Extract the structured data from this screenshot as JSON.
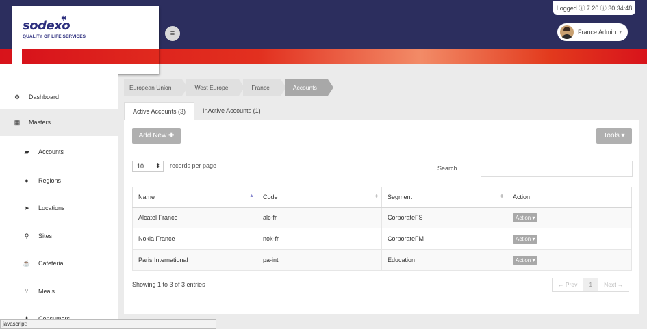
{
  "brand": {
    "name": "sodexo",
    "tagline": "QUALITY OF LIFE SERVICES",
    "primary_color": "#2c2e5e",
    "accent_color": "#d8131b"
  },
  "header": {
    "logged_text": "Logged ⓘ 7.26 ⓘ 30:34:48",
    "user_name": "France Admin",
    "menu_icon": "hamburger-icon"
  },
  "sidebar": {
    "items": [
      {
        "label": "Dashboard",
        "icon": "dashboard-icon"
      },
      {
        "label": "Masters",
        "icon": "grid-icon"
      },
      {
        "label": "Accounts",
        "icon": "briefcase-icon"
      },
      {
        "label": "Regions",
        "icon": "globe-icon"
      },
      {
        "label": "Locations",
        "icon": "location-arrow-icon"
      },
      {
        "label": "Sites",
        "icon": "map-marker-icon"
      },
      {
        "label": "Cafeteria",
        "icon": "coffee-icon"
      },
      {
        "label": "Meals",
        "icon": "cutlery-icon"
      },
      {
        "label": "Consumers",
        "icon": "user-icon"
      }
    ]
  },
  "breadcrumb": [
    "European Union",
    "West Europe",
    "France",
    "Accounts"
  ],
  "tabs": [
    {
      "label": "Active Accounts (3)",
      "active": true
    },
    {
      "label": "InActive Accounts (1)",
      "active": false
    }
  ],
  "toolbar": {
    "add_label": "Add New",
    "tools_label": "Tools"
  },
  "table_controls": {
    "page_length": "10",
    "length_suffix": "records per page",
    "search_label": "Search",
    "search_value": ""
  },
  "table": {
    "columns": [
      "Name",
      "Code",
      "Segment",
      "Action"
    ],
    "rows": [
      {
        "name": "Alcatel France",
        "code": "alc-fr",
        "segment": "CorporateFS",
        "action": "Action"
      },
      {
        "name": "Nokia France",
        "code": "nok-fr",
        "segment": "CorporateFM",
        "action": "Action"
      },
      {
        "name": "Paris International",
        "code": "pa-intl",
        "segment": "Education",
        "action": "Action"
      }
    ]
  },
  "footer": {
    "info": "Showing 1 to 3 of 3 entries",
    "prev": "← Prev",
    "page": "1",
    "next": "Next →"
  },
  "statusbar": {
    "text": "javascript:"
  }
}
